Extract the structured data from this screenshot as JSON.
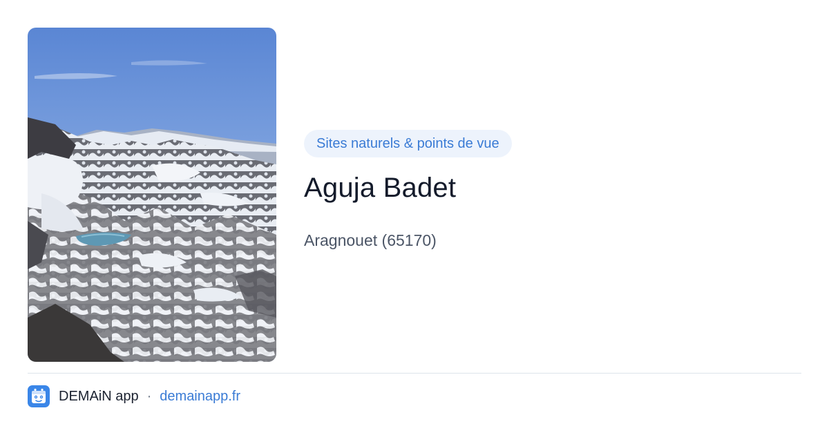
{
  "category_tag": "Sites naturels & points de vue",
  "place": {
    "title": "Aguja Badet",
    "location": "Aragnouet (65170)"
  },
  "footer": {
    "app_name": "DEMAiN app",
    "separator": "·",
    "link_text": "demainapp.fr",
    "logo_icon": "demain-app-logo-icon"
  },
  "colors": {
    "accent": "#3a7bd5",
    "tag_background": "#edf3fc",
    "title": "#141b2b",
    "logo_background": "#3a86e8"
  },
  "photo": {
    "subject": "snowy-mountain-landscape-image"
  }
}
